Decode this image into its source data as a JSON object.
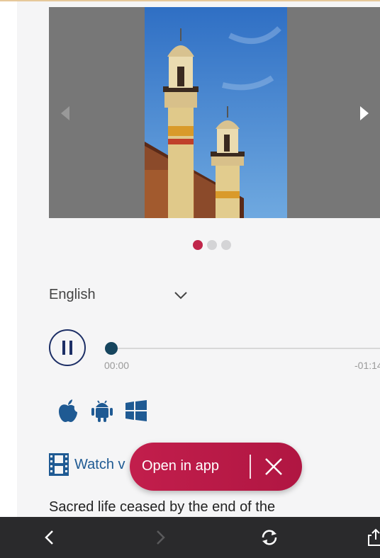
{
  "carousel": {
    "slide_count": 3,
    "active_slide": 1
  },
  "audio": {
    "language": "English",
    "time_elapsed": "00:00",
    "time_remaining": "-01:14",
    "progress": 0.0,
    "state": "playing"
  },
  "platforms": [
    "apple-icon",
    "android-icon",
    "windows-icon"
  ],
  "watch": {
    "label": "Watch v",
    "icon": "film-icon"
  },
  "banner": {
    "open_label": "Open in app",
    "close_icon": "close-icon"
  },
  "description": {
    "text": "Sacred life ceased by the end of the"
  },
  "browser_bar": {
    "buttons": [
      "back-icon",
      "forward-icon",
      "refresh-icon",
      "share-icon"
    ]
  },
  "colors": {
    "accent": "#c0264a",
    "link": "#1f5a93",
    "play_ring": "#1d2f66",
    "bottom_bar": "#2a2a2c"
  }
}
